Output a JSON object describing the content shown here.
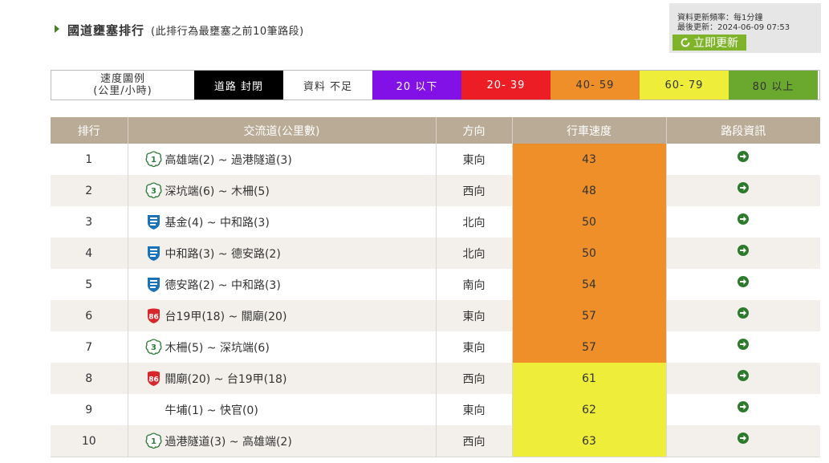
{
  "header": {
    "title": "國道壅塞排行",
    "subtitle": "(此排行為最壅塞之前10筆路段)"
  },
  "update": {
    "frequency": "資料更新頻率：每1分鐘",
    "last_update": "最後更新：2024-06-09 07:53",
    "button_label": "立即更新"
  },
  "legend": {
    "label_line1": "速度圖例",
    "label_line2": "(公里/小時)",
    "items": [
      {
        "label": "道路 封閉",
        "bg": "#000000",
        "color": "#ffffff"
      },
      {
        "label": "資料 不足",
        "bg": "#ffffff",
        "color": "#333333"
      },
      {
        "label": "20 以下",
        "bg": "#8211e8",
        "color": "#ffffff"
      },
      {
        "label": "20- 39",
        "bg": "#ec1d24",
        "color": "#ffffff"
      },
      {
        "label": "40- 59",
        "bg": "#ee8f2a",
        "color": "#333333"
      },
      {
        "label": "60- 79",
        "bg": "#eded3a",
        "color": "#333333"
      },
      {
        "label": "80 以上",
        "bg": "#6aa82e",
        "color": "#333333"
      }
    ]
  },
  "table": {
    "headers": [
      "排行",
      "交流道(公里數)",
      "方向",
      "行車速度",
      "路段資訊"
    ],
    "rows": [
      {
        "rank": "1",
        "icon": "national-highway-1-shield-icon",
        "section": "高雄端(2) ~ 過港隧道(3)",
        "direction": "東向",
        "speed": "43",
        "speed_color": "#ee8f2a"
      },
      {
        "rank": "2",
        "icon": "national-highway-3-shield-icon",
        "section": "深坑端(6) ~ 木柵(5)",
        "direction": "西向",
        "speed": "48",
        "speed_color": "#ee8f2a"
      },
      {
        "rank": "3",
        "icon": "freeway-shield-icon",
        "section": "基金(4) ~ 中和路(3)",
        "direction": "北向",
        "speed": "50",
        "speed_color": "#ee8f2a"
      },
      {
        "rank": "4",
        "icon": "freeway-shield-icon",
        "section": "中和路(3) ~ 德安路(2)",
        "direction": "北向",
        "speed": "50",
        "speed_color": "#ee8f2a"
      },
      {
        "rank": "5",
        "icon": "freeway-shield-icon",
        "section": "德安路(2) ~ 中和路(3)",
        "direction": "南向",
        "speed": "54",
        "speed_color": "#ee8f2a"
      },
      {
        "rank": "6",
        "icon": "expressway-86-shield-icon",
        "section": "台19甲(18) ~ 關廟(20)",
        "direction": "東向",
        "speed": "57",
        "speed_color": "#ee8f2a"
      },
      {
        "rank": "7",
        "icon": "national-highway-3-shield-icon",
        "section": "木柵(5) ~ 深坑端(6)",
        "direction": "東向",
        "speed": "57",
        "speed_color": "#ee8f2a"
      },
      {
        "rank": "8",
        "icon": "expressway-86-shield-icon",
        "section": "關廟(20) ~ 台19甲(18)",
        "direction": "西向",
        "speed": "61",
        "speed_color": "#eded3a"
      },
      {
        "rank": "9",
        "icon": "",
        "section": "牛埔(1) ~ 快官(0)",
        "direction": "東向",
        "speed": "62",
        "speed_color": "#eded3a"
      },
      {
        "rank": "10",
        "icon": "national-highway-1-shield-icon",
        "section": "過港隧道(3) ~ 高雄端(2)",
        "direction": "西向",
        "speed": "63",
        "speed_color": "#eded3a"
      }
    ]
  }
}
